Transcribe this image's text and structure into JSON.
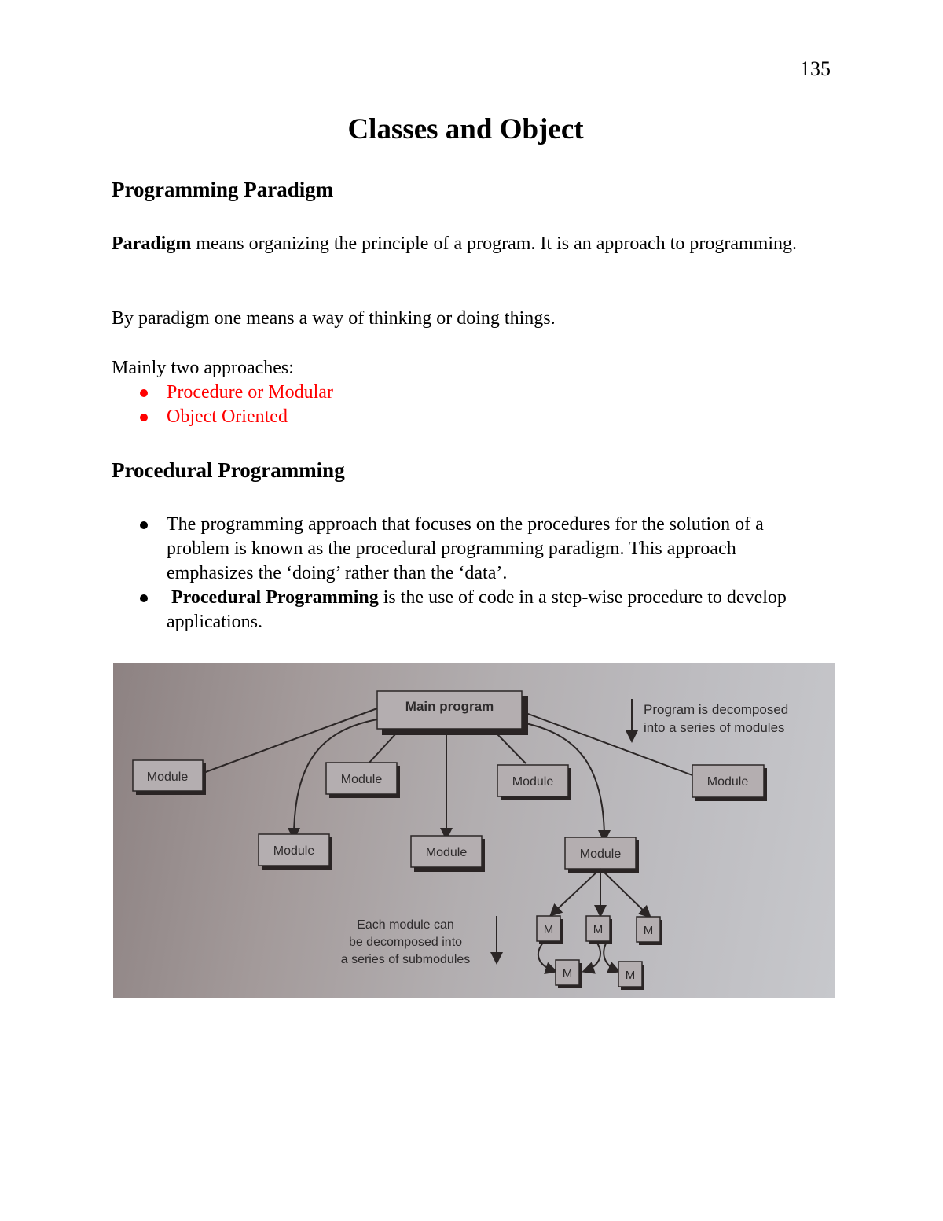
{
  "page_number": "135",
  "title": "Classes and Object",
  "sections": [
    {
      "heading": "Programming Paradigm",
      "paragraphs": [
        {
          "bold": "Paradigm",
          "text": " means organizing the principle of a program. It is an approach to programming."
        },
        {
          "text": "By paradigm one means a way of thinking or doing things."
        },
        {
          "text": "Mainly two approaches:"
        }
      ],
      "approaches": [
        "Procedure or Modular",
        "Object Oriented"
      ],
      "approach_color": "#ff0000"
    },
    {
      "heading": "Procedural Programming",
      "bullets": [
        {
          "bold": "",
          "text": "The programming approach that focuses on the procedures for the solution of a problem is known as the procedural programming paradigm. This approach emphasizes the ‘doing’ rather than the ‘data’."
        },
        {
          "bold": "Procedural Programming",
          "text": " is the use of code in a step-wise procedure to develop applications."
        }
      ]
    }
  ],
  "figure": {
    "root": "Main program",
    "modules": [
      "Module",
      "Module",
      "Module",
      "Module",
      "Module",
      "Module",
      "Module"
    ],
    "submodules": [
      "M",
      "M",
      "M",
      "M",
      "M"
    ],
    "note_top": [
      "Program is decomposed",
      "into a series of modules"
    ],
    "note_bottom": [
      "Each module can",
      "be decomposed into",
      "a series of submodules"
    ]
  }
}
